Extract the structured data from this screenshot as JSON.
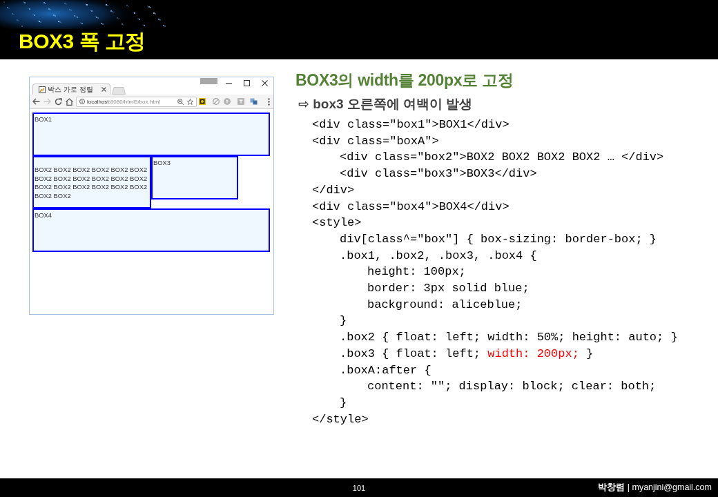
{
  "header": {
    "title": "BOX3 폭 고정"
  },
  "browser": {
    "tab": {
      "title": "박스 가로 정렬"
    },
    "navigation": [
      {
        "kind": "back",
        "disabled": false
      },
      {
        "kind": "forward",
        "disabled": true
      },
      {
        "kind": "reload",
        "disabled": false
      },
      {
        "kind": "home",
        "disabled": false
      }
    ],
    "address": {
      "host": "localhost",
      "path": ":8080/html5/box.html"
    },
    "page": {
      "rows": [
        {
          "boxes": [
            {
              "kind": "full",
              "label": "BOX1"
            }
          ]
        },
        {
          "boxes": [
            {
              "kind": "half",
              "label": "BOX2 BOX2 BOX2 BOX2 BOX2 BOX2 BOX2 BOX2 BOX2 BOX2 BOX2 BOX2 BOX2 BOX2 BOX2 BOX2 BOX2 BOX2 BOX2 BOX2"
            },
            {
              "kind": "fixed",
              "label": "BOX3"
            }
          ]
        },
        {
          "boxes": [
            {
              "kind": "full",
              "label": "BOX4"
            }
          ]
        }
      ]
    }
  },
  "heading": "BOX3의 width를 200px로 고정",
  "subheading": "⇨ box3 오른쪽에 여백이 발생",
  "code": {
    "lines": [
      {
        "text": "<div class=\"box1\">BOX1</div>"
      },
      {
        "text": "<div class=\"boxA\">",
        "children": [
          {
            "text": "<div class=\"box2\">BOX2 BOX2 BOX2 BOX2 … </div>"
          },
          {
            "text": "<div class=\"box3\">BOX3</div>"
          }
        ]
      },
      {
        "text": "</div>"
      },
      {
        "text": "<div class=\"box4\">BOX4</div>"
      },
      {
        "text": "<style>",
        "children": [
          {
            "text": "div[class^=\"box\"] { box-sizing: border-box; }"
          },
          {
            "text": ".box1, .box2, .box3, .box4 {",
            "children": [
              {
                "text": "height: 100px;"
              },
              {
                "text": "border: 3px solid blue;"
              },
              {
                "text": "background: aliceblue;"
              }
            ]
          },
          {
            "text": "}"
          },
          {
            "text": ".box2 { float: left; width: 50%; height: auto; }"
          },
          {
            "segments": [
              {
                "text": ".box3 { float: left; ",
                "highlighted": false
              },
              {
                "text": "width: 200px;",
                "highlighted": true
              },
              {
                "text": " }",
                "highlighted": false
              }
            ]
          },
          {
            "text": ".boxA:after {",
            "children": [
              {
                "text": "content: \"\"; display: block; clear: both;"
              }
            ]
          },
          {
            "text": "}"
          }
        ]
      },
      {
        "text": "</style>"
      }
    ]
  },
  "footer": {
    "page_number": "101",
    "credit": "**박창렴** | myanjini@gmail.com"
  }
}
